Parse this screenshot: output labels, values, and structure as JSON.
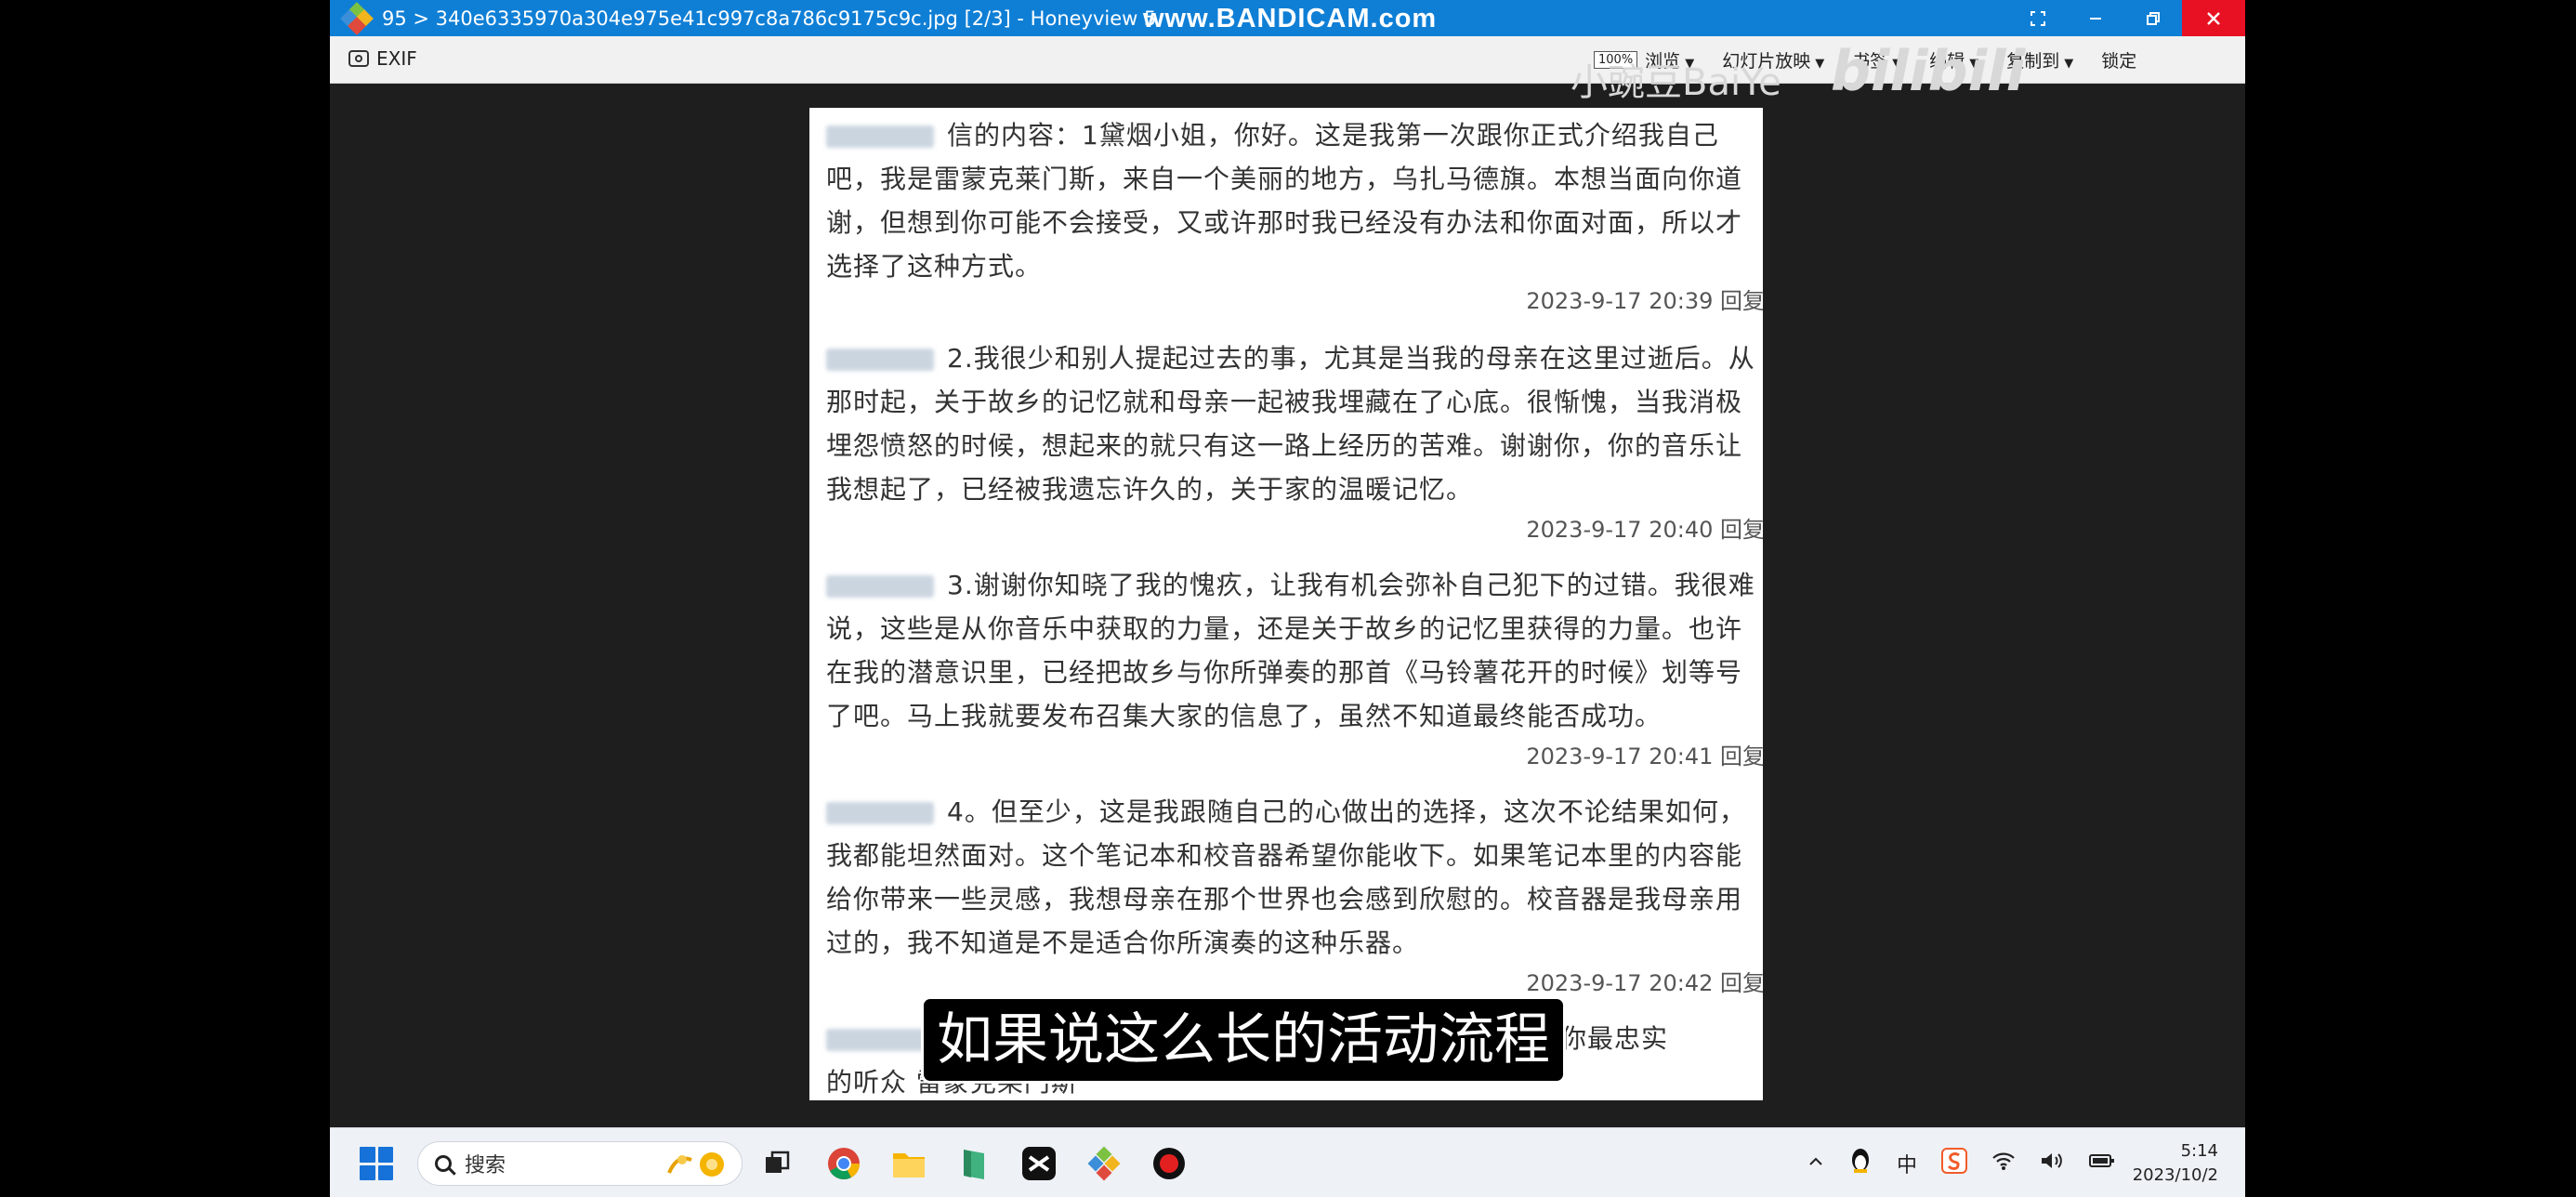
{
  "window": {
    "title": "95 > 340e6335970a304e975e41c997c8a786c9175c9c.jpg [2/3] - Honeyview 5",
    "recorder_watermark": "www.BANDICAM.com"
  },
  "toolbar": {
    "exif_label": "EXIF",
    "zoom_badge": "100%",
    "items": [
      "浏览",
      "幻灯片放映",
      "书签",
      "编辑",
      "复制到",
      "锁定"
    ]
  },
  "watermark": {
    "uploader": "小豌豆BaiYe",
    "logo": "bilibili"
  },
  "comments": [
    {
      "text": "信的内容：1黛烟小姐，你好。这是我第一次跟你正式介绍我自己吧，我是雷蒙克莱门斯，来自一个美丽的地方，乌扎马德旗。本想当面向你道谢，但想到你可能不会接受，又或许那时我已经没有办法和你面对面，所以才选择了这种方式。",
      "time": "2023-9-17 20:39",
      "reply": "回复"
    },
    {
      "text": "2.我很少和别人提起过去的事，尤其是当我的母亲在这里过逝后。从那时起，关于故乡的记忆就和母亲一起被我埋藏在了心底。很惭愧，当我消极埋怨愤怒的时候，想起来的就只有这一路上经历的苦难。谢谢你，你的音乐让我想起了，已经被我遗忘许久的，关于家的温暖记忆。",
      "time": "2023-9-17 20:40",
      "reply": "回复"
    },
    {
      "text": "3.谢谢你知晓了我的愧疚，让我有机会弥补自己犯下的过错。我很难说，这些是从你音乐中获取的力量，还是关于故乡的记忆里获得的力量。也许在我的潜意识里，已经把故乡与你所弹奏的那首《马铃薯花开的时候》划等号了吧。马上我就要发布召集大家的信息了，虽然不知道最终能否成功。",
      "time": "2023-9-17 20:41",
      "reply": "回复"
    },
    {
      "text": "4。但至少，这是我跟随自己的心做出的选择，这次不论结果如何，我都能坦然面对。这个笔记本和校音器希望你能收下。如果笔记本里的内容能给你带来一些灵感，我想母亲在那个世界也会感到欣慰的。校音器是我母亲用过的，我不知道是不是适合你所演奏的这种乐器。",
      "time": "2023-9-17 20:42",
      "reply": "回复"
    }
  ],
  "partial_comment": {
    "line1_tail": "你最忠实",
    "line2": "的听众 雷蒙克莱门斯"
  },
  "subtitle": "如果说这么长的活动流程",
  "taskbar": {
    "search_placeholder": "搜索",
    "clock_time": "5:14",
    "clock_date": "2023/10/2",
    "ime": "中"
  }
}
